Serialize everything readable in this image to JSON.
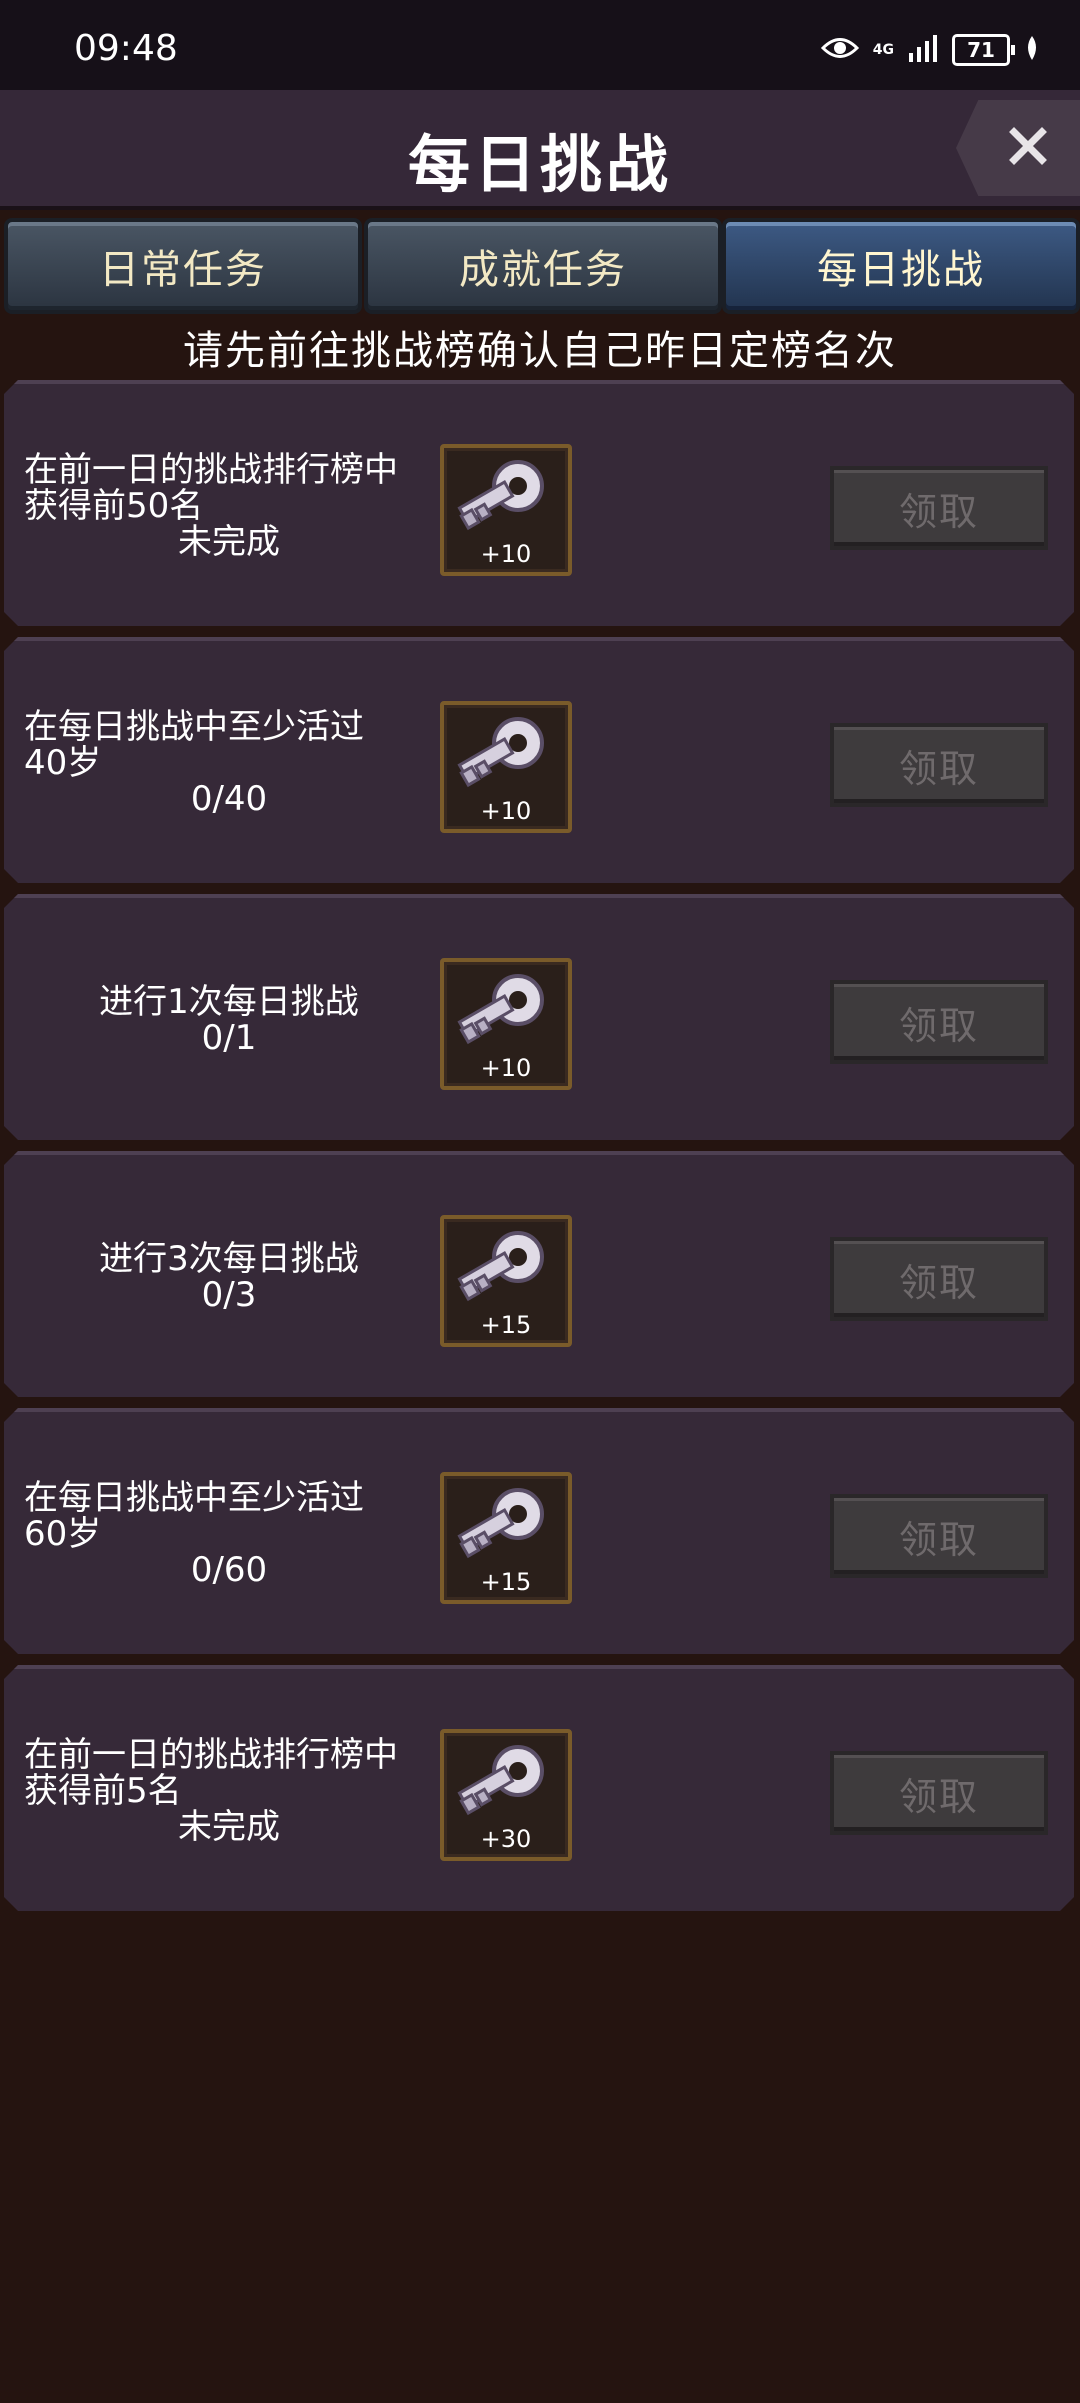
{
  "status_bar": {
    "time": "09:48",
    "network": "4G",
    "battery": "71"
  },
  "header": {
    "title": "每日挑战"
  },
  "tabs": [
    {
      "label": "日常任务",
      "active": false
    },
    {
      "label": "成就任务",
      "active": false
    },
    {
      "label": "每日挑战",
      "active": true
    }
  ],
  "notice": "请先前往挑战榜确认自己昨日定榜名次",
  "tasks": [
    {
      "line1": "在前一日的挑战排行榜中",
      "line2": "获得前50名",
      "progress": "未完成",
      "reward": "+10",
      "button": "领取"
    },
    {
      "line1": "在每日挑战中至少活过",
      "line2": "40岁",
      "progress": "0/40",
      "reward": "+10",
      "button": "领取"
    },
    {
      "line1": "进行1次每日挑战",
      "line2": "",
      "progress": "0/1",
      "reward": "+10",
      "button": "领取"
    },
    {
      "line1": "进行3次每日挑战",
      "line2": "",
      "progress": "0/3",
      "reward": "+15",
      "button": "领取"
    },
    {
      "line1": "在每日挑战中至少活过",
      "line2": "60岁",
      "progress": "0/60",
      "reward": "+15",
      "button": "领取"
    },
    {
      "line1": "在前一日的挑战排行榜中",
      "line2": "获得前5名",
      "progress": "未完成",
      "reward": "+30",
      "button": "领取"
    }
  ],
  "icons": {
    "close": "close-icon",
    "reward": "key-icon",
    "visibility": "eye-icon",
    "signal": "signal-icon",
    "battery": "battery-icon"
  }
}
